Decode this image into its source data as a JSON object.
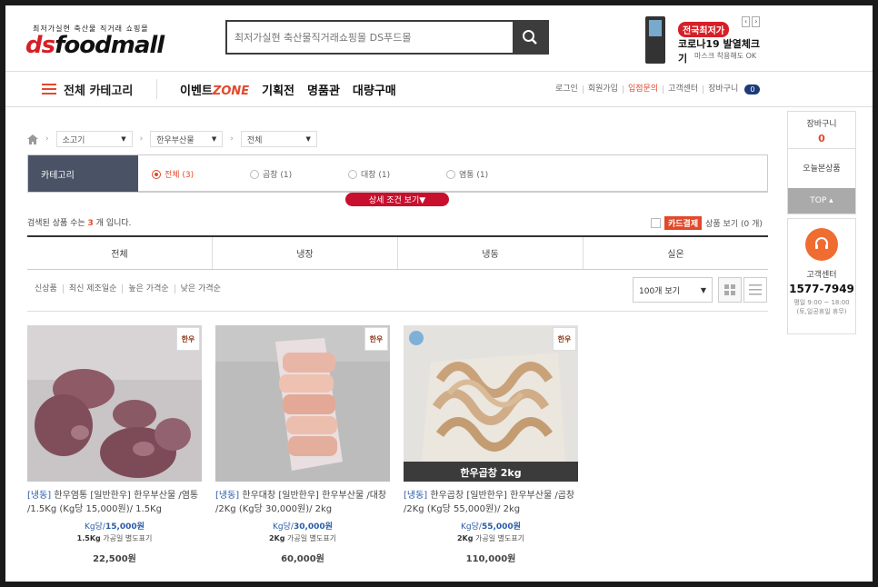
{
  "header": {
    "logo_tagline": "최저가실현 축산물 직거래 쇼핑몰",
    "logo_ds": "ds",
    "logo_foodmall": "foodmall",
    "search_placeholder": "최저가실현 축산물직거래쇼핑몰 DS푸드몰",
    "banner": {
      "badge": "전국최저가",
      "title": "코로나19 발열체크기",
      "subtitle": "마스크 착용해도 OK",
      "prev": "‹",
      "next": "›"
    }
  },
  "nav": {
    "all_category": "전체 카테고리",
    "menu": [
      {
        "label": "이벤트",
        "accent": "ZONE"
      },
      {
        "label": "기획전"
      },
      {
        "label": "명품관"
      },
      {
        "label": "대량구매"
      }
    ],
    "util": [
      "로그인",
      "회원가입",
      "입점문의",
      "고객센터",
      "장바구니"
    ],
    "cart_count": "0"
  },
  "breadcrumb": [
    "소고기",
    "한우부산물",
    "전체"
  ],
  "category_filter": {
    "label": "카테고리",
    "options": [
      {
        "label": "전체 (3)",
        "checked": true
      },
      {
        "label": "곱창 (1)",
        "checked": false
      },
      {
        "label": "대창 (1)",
        "checked": false
      },
      {
        "label": "염통 (1)",
        "checked": false
      }
    ],
    "detail_button": "상세 조건  보기▼"
  },
  "result": {
    "prefix": "검색된 상품 수는 ",
    "count": "3",
    "suffix": " 개 입니다."
  },
  "card_payment": {
    "tag": "카드결제",
    "text": "상품 보기 (0 개)"
  },
  "storage_tabs": [
    "전체",
    "냉장",
    "냉동",
    "실온"
  ],
  "sort_options": [
    "신상품",
    "최신 제조일순",
    "높은 가격순",
    "낮은 가격순"
  ],
  "per_page": "100개 보기",
  "products": [
    {
      "tag": "[냉동]",
      "name": " 한우염통 [일반한우] 한우부산물 /염통 /1.5Kg (Kg당 15,000원)/ 1.5Kg",
      "kg_price": "15,000원",
      "kg_prefix": "Kg당/",
      "weight": "1.5Kg",
      "note": "가공일 별도표기",
      "price": "22,500원",
      "brand": "한우"
    },
    {
      "tag": "[냉동]",
      "name": " 한우대창 [일반한우] 한우부산물 /대창 /2Kg (Kg당 30,000원)/ 2kg",
      "kg_price": "30,000원",
      "kg_prefix": "Kg당/",
      "weight": "2Kg",
      "note": "가공일 별도표기",
      "price": "60,000원",
      "brand": "한우"
    },
    {
      "tag": "[냉동]",
      "name": " 한우곱창 [일반한우] 한우부산물 /곱창 /2Kg (Kg당 55,000원)/ 2kg",
      "kg_price": "55,000원",
      "kg_prefix": "Kg당/",
      "weight": "2Kg",
      "note": "가공일 별도표기",
      "price": "110,000원",
      "brand": "한우",
      "image_caption": "한우곱창 2kg"
    }
  ],
  "sidebar": {
    "cart_label": "장바구니",
    "cart_count": "0",
    "today_label": "오늘본상품",
    "top_label": "TOP ▴",
    "cs_label": "고객센터",
    "cs_phone": "1577-7949",
    "cs_hours": "평일 9:00 ~ 18:00",
    "cs_holiday": "(토,일공휴일 휴무)"
  }
}
